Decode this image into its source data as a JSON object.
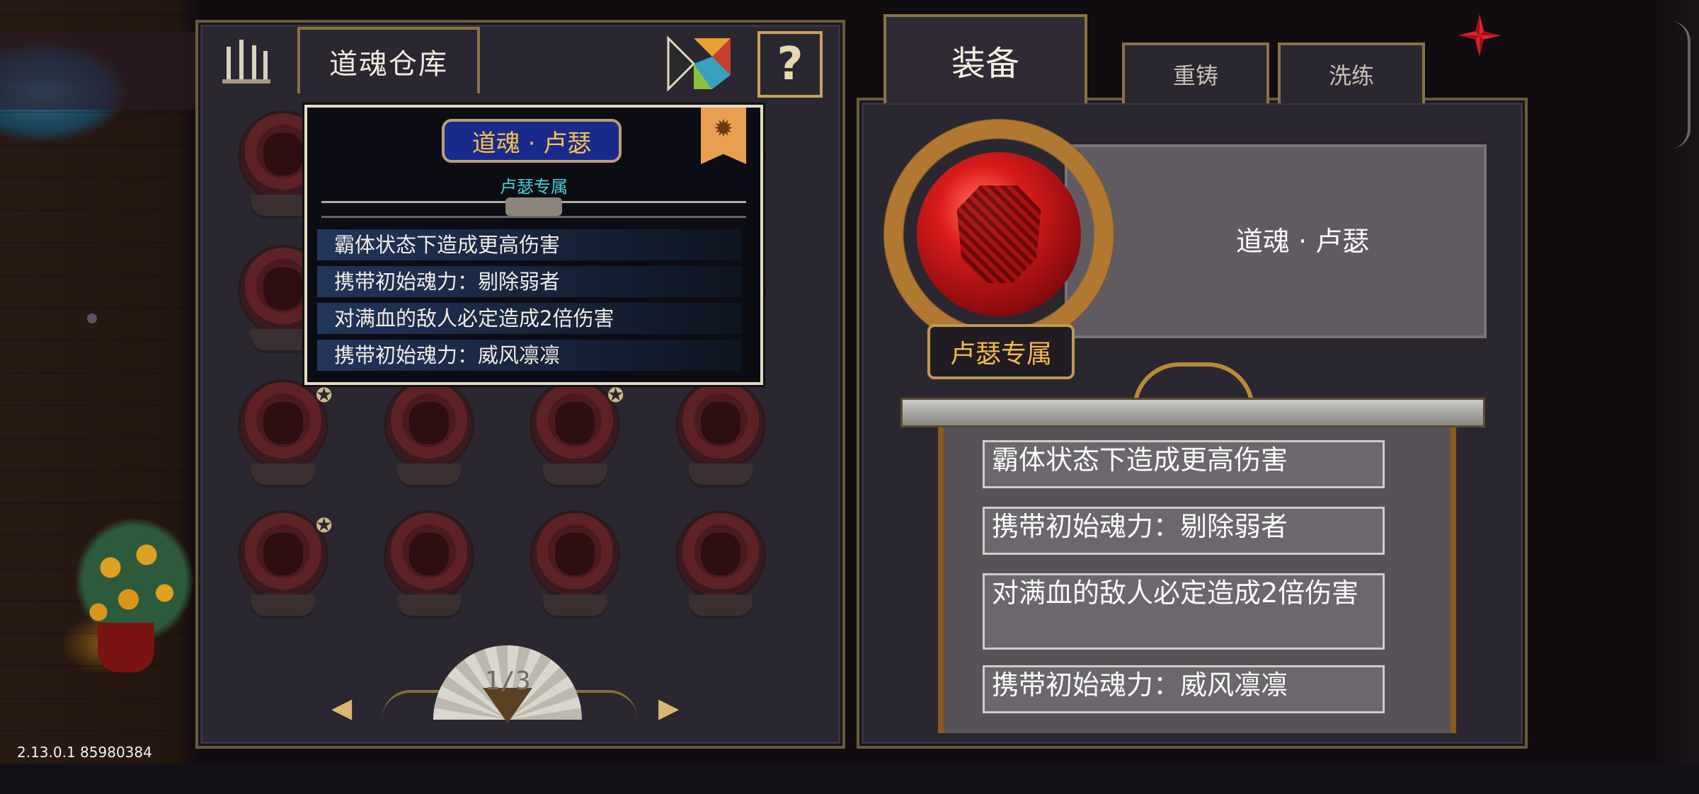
{
  "warehouse": {
    "title": "道魂仓库",
    "help_label": "?",
    "page_indicator": "1/3",
    "prev_label": "◀",
    "next_label": "▶"
  },
  "tooltip": {
    "title": "道魂 · 卢瑟",
    "subtitle": "卢瑟专属",
    "effects": [
      "霸体状态下造成更高伤害",
      "携带初始魂力：剔除弱者",
      "对满血的敌人必定造成2倍伤害",
      "携带初始魂力：威风凛凛"
    ]
  },
  "tabs": {
    "equip": "装备",
    "recast": "重铸",
    "refine": "洗练"
  },
  "detail": {
    "name": "道魂 · 卢瑟",
    "exclusive_tag": "卢瑟专属",
    "effects": [
      "霸体状态下造成更高伤害",
      "携带初始魂力：剔除弱者",
      "对满血的敌人必定造成2倍伤害",
      "携带初始魂力：威风凛凛"
    ]
  },
  "version": "2.13.0.1 85980384",
  "colors": {
    "accent_gold": "#f2b94a",
    "subtitle_cyan": "#4ad0d8",
    "orb_red": "#d81c1a"
  }
}
